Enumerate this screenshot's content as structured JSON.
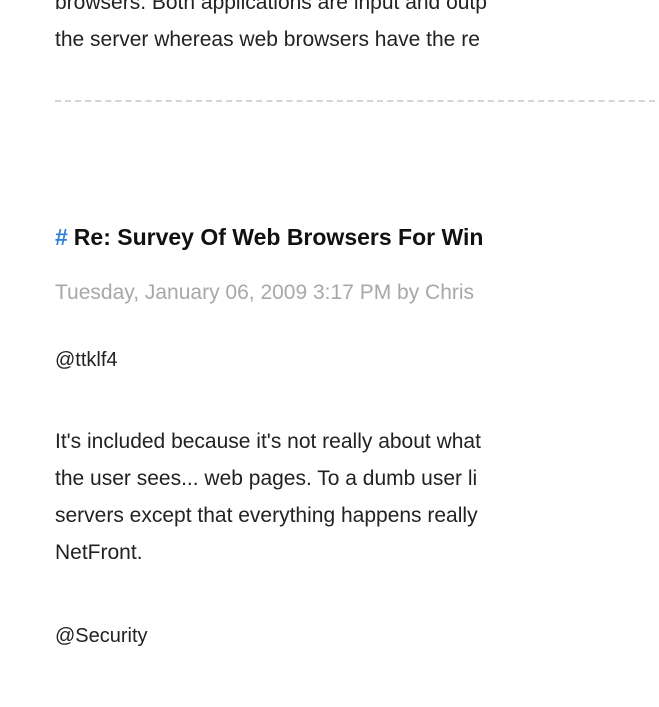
{
  "previous_comment": {
    "text_lines": [
      "browsers. Both applications are input and outp",
      "the server whereas web browsers have the re"
    ]
  },
  "comment": {
    "hash": "#",
    "title": "Re: Survey Of Web Browsers For Win",
    "meta": "Tuesday, January 06, 2009 3:17 PM by Chris",
    "mention1": "@ttklf4",
    "body_lines": [
      "It's included because it's not really about what",
      "the user sees... web pages. To a dumb user li",
      "servers except that everything happens really",
      "NetFront."
    ],
    "mention2": "@Security"
  }
}
